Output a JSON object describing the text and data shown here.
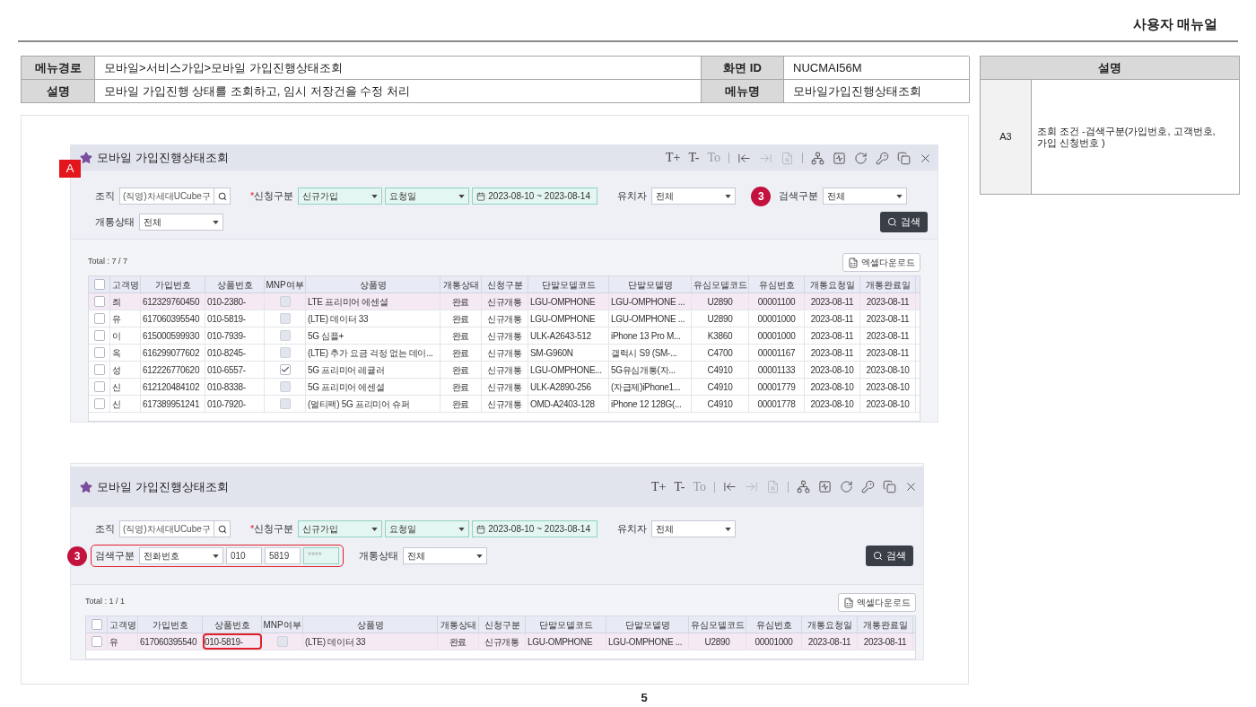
{
  "doc_title": "사용자 매뉴얼",
  "info_table": {
    "rows": [
      [
        {
          "label": "메뉴경로",
          "value": "모바일>서비스가입>모바일 가입진행상태조회"
        },
        {
          "label": "화면 ID",
          "value": "NUCMAI56M"
        }
      ],
      [
        {
          "label": "설명",
          "value": "모바일 가입진행 상태를 조회하고, 임시 저장건을 수정 처리"
        },
        {
          "label": "메뉴명",
          "value": "모바일가입진행상태조회"
        }
      ]
    ]
  },
  "screenshots": [
    {
      "callout": {
        "text": "A"
      },
      "title": "모바일 가입진행상태조회",
      "toolbar": {
        "text_buttons": [
          {
            "label": "T+",
            "disabled": false
          },
          {
            "label": "T-",
            "disabled": false
          },
          {
            "label": "To",
            "disabled": true
          }
        ],
        "icon_groups": [
          [
            {
              "disabled": false
            },
            {
              "disabled": true
            },
            {
              "disabled": true
            }
          ],
          [
            {
              "disabled": false
            },
            {
              "disabled": false
            },
            {
              "disabled": false
            },
            {
              "disabled": false
            },
            {
              "disabled": false
            },
            {
              "disabled": false
            }
          ]
        ]
      },
      "form": {
        "rows": [
          [
            {
              "label": "조직",
              "highlighted": false,
              "controls": [
                {
                  "kind": "lookup",
                  "value": "(직영)차세대UCube구"
                }
              ]
            },
            {
              "required_mark": "*",
              "label": "신청구분",
              "highlighted": false,
              "controls": [
                {
                  "kind": "select",
                  "value": "신규가입",
                  "tinted": true
                },
                {
                  "kind": "select",
                  "value": "요청일",
                  "tinted": true
                },
                {
                  "kind": "date_range",
                  "value": "2023-08-10 ~ 2023-08-14",
                  "tinted": true
                }
              ]
            },
            {
              "label": "유치자",
              "highlighted": false,
              "controls": [
                {
                  "kind": "select",
                  "value": "전체",
                  "tinted": false
                }
              ]
            },
            {
              "marker": "3",
              "label": "검색구분",
              "highlighted": false,
              "controls": [
                {
                  "kind": "select",
                  "value": "전체",
                  "tinted": false
                }
              ]
            }
          ],
          [
            {
              "label": "개통상태",
              "highlighted": false,
              "controls": [
                {
                  "kind": "select",
                  "value": "전체",
                  "tinted": false
                }
              ]
            }
          ]
        ],
        "search_button": "검색"
      },
      "total": "Total : 7 / 7",
      "excel_button": "엑셀다운로드",
      "table": {
        "select_all": {
          "checked": false
        },
        "columns": [
          {
            "label": "고객명"
          },
          {
            "label": "가입번호"
          },
          {
            "label": "상품번호"
          },
          {
            "label": "MNP여부"
          },
          {
            "label": "상품명"
          },
          {
            "label": "개통상태"
          },
          {
            "label": "신청구분"
          },
          {
            "label": "단말모델코드"
          },
          {
            "label": "단말모델명"
          },
          {
            "label": "유심모델코드"
          },
          {
            "label": "유심번호"
          },
          {
            "label": "개통요청일"
          },
          {
            "label": "개통완료일"
          }
        ],
        "rows": [
          {
            "selected": true,
            "checked": false,
            "product_no_marked": false,
            "cells": [
              "최",
              "612329760450",
              "010-2380-",
              {
                "kind": "checkbox",
                "checked": false
              },
              "LTE 프리미어 에센셜",
              "완료",
              "신규개통",
              "LGU-OMPHONE",
              "LGU-OMPHONE ...",
              "U2890",
              "00001100",
              "2023-08-11",
              "2023-08-11"
            ]
          },
          {
            "selected": false,
            "checked": false,
            "product_no_marked": false,
            "cells": [
              "유",
              "617060395540",
              "010-5819-",
              {
                "kind": "checkbox",
                "checked": false
              },
              "(LTE) 데이터 33",
              "완료",
              "신규개통",
              "LGU-OMPHONE",
              "LGU-OMPHONE ...",
              "U2890",
              "00001000",
              "2023-08-11",
              "2023-08-11"
            ]
          },
          {
            "selected": false,
            "checked": false,
            "product_no_marked": false,
            "cells": [
              "이",
              "615000599930",
              "010-7939-",
              {
                "kind": "checkbox",
                "checked": false
              },
              "5G 심플+",
              "완료",
              "신규개통",
              "ULK-A2643-512",
              "iPhone 13 Pro M...",
              "K3860",
              "00001000",
              "2023-08-11",
              "2023-08-11"
            ]
          },
          {
            "selected": false,
            "checked": false,
            "product_no_marked": false,
            "cells": [
              "옥",
              "616299077602",
              "010-8245-",
              {
                "kind": "checkbox",
                "checked": false
              },
              "(LTE) 추가 요금 걱정 없는 데이...",
              "완료",
              "신규개통",
              "SM-G960N",
              "갤럭시 S9 (SM-...",
              "C4700",
              "00001167",
              "2023-08-11",
              "2023-08-11"
            ]
          },
          {
            "selected": false,
            "checked": false,
            "product_no_marked": false,
            "cells": [
              "성",
              "612226770620",
              "010-6557-",
              {
                "kind": "checkbox",
                "checked": true
              },
              "5G 프리미어 레귤러",
              "완료",
              "신규개통",
              "LGU-OMPHONE...",
              "5G유심개통(자...",
              "C4910",
              "00001133",
              "2023-08-10",
              "2023-08-10"
            ]
          },
          {
            "selected": false,
            "checked": false,
            "product_no_marked": false,
            "cells": [
              "신",
              "612120484102",
              "010-8338-",
              {
                "kind": "checkbox",
                "checked": false
              },
              "5G 프리미어 에센셜",
              "완료",
              "신규개통",
              "ULK-A2890-256",
              "(자급제)iPhone1...",
              "C4910",
              "00001779",
              "2023-08-10",
              "2023-08-10"
            ]
          },
          {
            "selected": false,
            "checked": false,
            "product_no_marked": false,
            "cells": [
              "신",
              "617389951241",
              "010-7920-",
              {
                "kind": "checkbox",
                "checked": false
              },
              "(멀티팩) 5G 프리미어 슈퍼",
              "완료",
              "신규개통",
              "OMD-A2403-128",
              "iPhone 12 128G(...",
              "C4910",
              "00001778",
              "2023-08-10",
              "2023-08-10"
            ]
          }
        ]
      }
    },
    {
      "title": "모바일 가입진행상태조회",
      "toolbar": {
        "text_buttons": [
          {
            "label": "T+",
            "disabled": false
          },
          {
            "label": "T-",
            "disabled": false
          },
          {
            "label": "To",
            "disabled": true
          }
        ],
        "icon_groups": [
          [
            {
              "disabled": false
            },
            {
              "disabled": true
            },
            {
              "disabled": true
            }
          ],
          [
            {
              "disabled": false
            },
            {
              "disabled": false
            },
            {
              "disabled": false
            },
            {
              "disabled": false
            },
            {
              "disabled": false
            },
            {
              "disabled": false
            }
          ]
        ]
      },
      "form": {
        "rows": [
          [
            {
              "label": "조직",
              "highlighted": false,
              "controls": [
                {
                  "kind": "lookup",
                  "value": "(직영)차세대UCube구"
                }
              ]
            },
            {
              "required_mark": "*",
              "label": "신청구분",
              "highlighted": false,
              "controls": [
                {
                  "kind": "select",
                  "value": "신규가입",
                  "tinted": true
                },
                {
                  "kind": "select",
                  "value": "요청일",
                  "tinted": true
                },
                {
                  "kind": "date_range",
                  "value": "2023-08-10 ~ 2023-08-14",
                  "tinted": true
                }
              ]
            },
            {
              "label": "유치자",
              "highlighted": false,
              "controls": [
                {
                  "kind": "select",
                  "value": "전체",
                  "tinted": false
                }
              ]
            }
          ],
          [
            {
              "marker": "3",
              "label": "검색구분",
              "highlighted": true,
              "controls": [
                {
                  "kind": "select",
                  "value": "전화번호",
                  "tinted": false
                },
                {
                  "kind": "input",
                  "value": "010",
                  "tinted": false
                },
                {
                  "kind": "input",
                  "value": "5819",
                  "tinted": false
                },
                {
                  "kind": "input",
                  "placeholder": "****",
                  "tinted": true
                }
              ]
            },
            {
              "label": "개통상태",
              "highlighted": false,
              "controls": [
                {
                  "kind": "select",
                  "value": "전체",
                  "tinted": false
                }
              ]
            }
          ]
        ],
        "search_button": "검색"
      },
      "total": "Total : 1 / 1",
      "excel_button": "엑셀다운로드",
      "table": {
        "select_all": {
          "checked": false
        },
        "columns": [
          {
            "label": "고객명"
          },
          {
            "label": "가입번호"
          },
          {
            "label": "상품번호"
          },
          {
            "label": "MNP여부"
          },
          {
            "label": "상품명"
          },
          {
            "label": "개통상태"
          },
          {
            "label": "신청구분"
          },
          {
            "label": "단말모델코드"
          },
          {
            "label": "단말모델명"
          },
          {
            "label": "유심모델코드"
          },
          {
            "label": "유심번호"
          },
          {
            "label": "개통요청일"
          },
          {
            "label": "개통완료일"
          }
        ],
        "rows": [
          {
            "selected": true,
            "checked": false,
            "product_no_marked": true,
            "cells": [
              "유",
              "617060395540",
              "010-5819-",
              {
                "kind": "checkbox",
                "checked": false
              },
              "(LTE) 데이터 33",
              "완료",
              "신규개통",
              "LGU-OMPHONE",
              "LGU-OMPHONE ...",
              "U2890",
              "00001000",
              "2023-08-11",
              "2023-08-11"
            ]
          }
        ]
      }
    }
  ],
  "notes": {
    "header": "설명",
    "rows": [
      {
        "key": "A3",
        "text": "조회 조건 -검색구분(가입번호, 고객번호, 가입 신청번호 )"
      }
    ]
  },
  "page_number": "5"
}
